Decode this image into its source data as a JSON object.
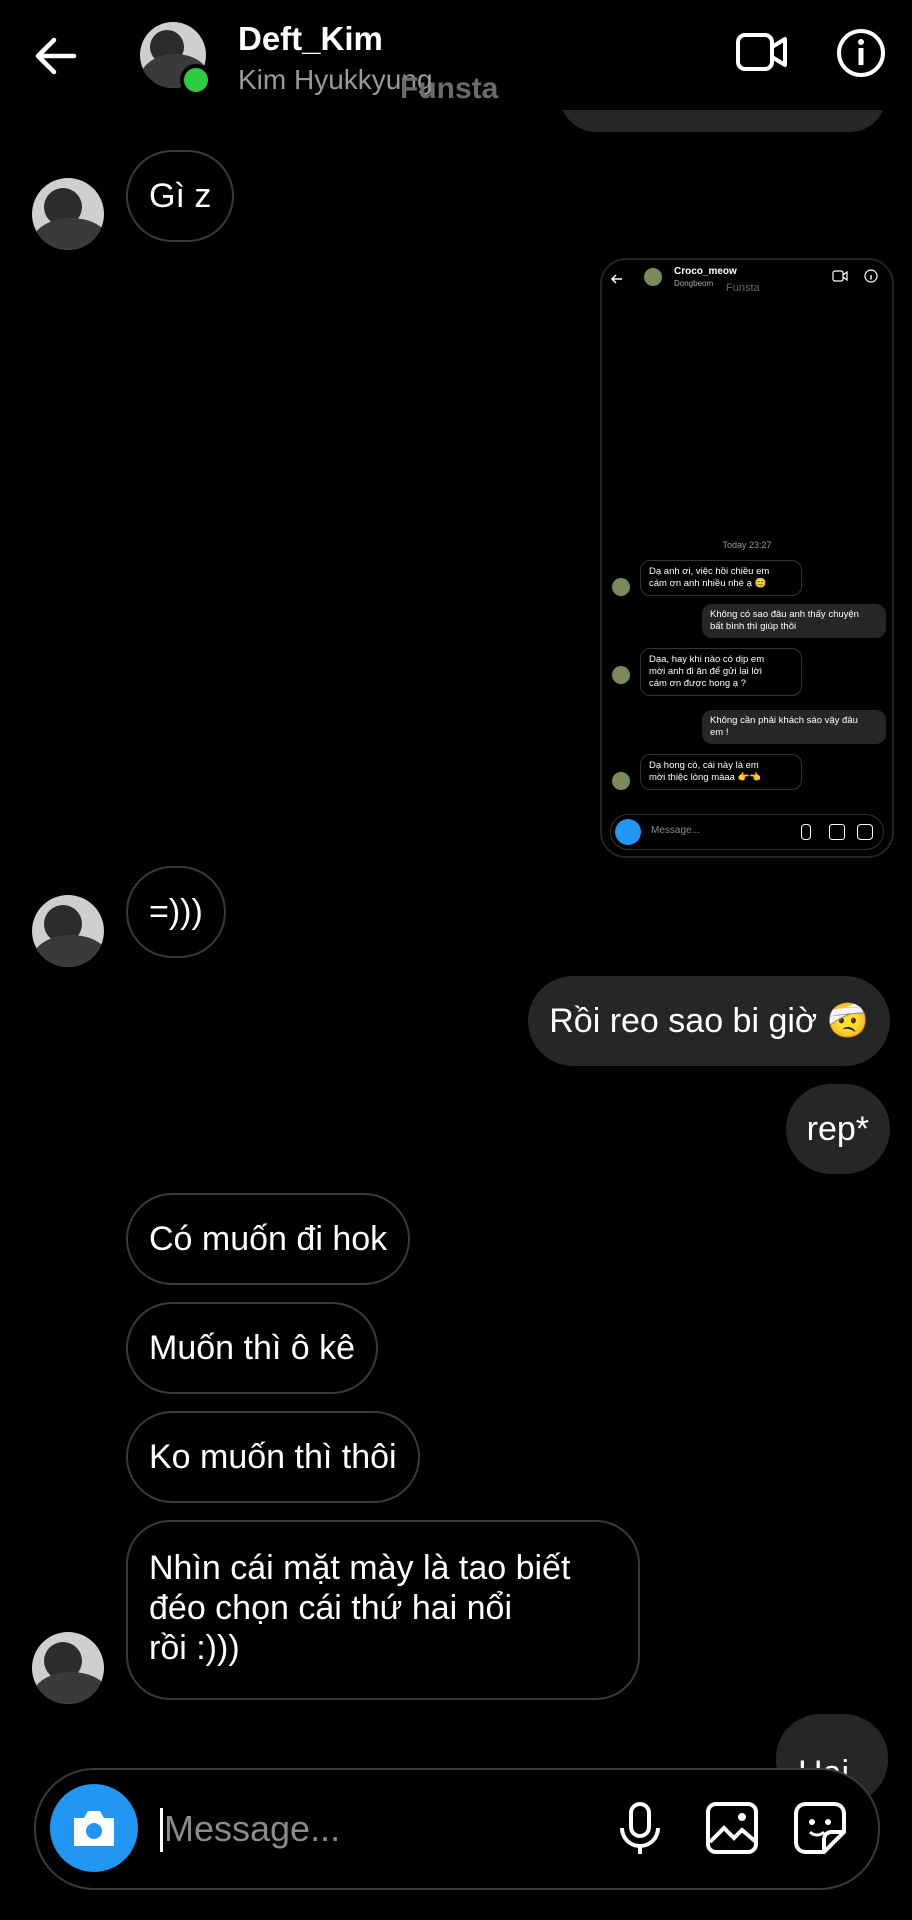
{
  "header": {
    "name": "Deft_Kim",
    "username": "Kim Hyukkyung",
    "overlay_text": "Funsta"
  },
  "messages": {
    "m1": "Gì z",
    "m2": "=)))",
    "m3": "Rồi reo sao bi giờ 🤕",
    "m4": "rep*",
    "m5": "Có muốn đi hok",
    "m6": "Muốn thì ô kê",
    "m7": "Ko muốn thì thôi",
    "m8_lines": [
      "Nhìn cái mặt mày là tao biết",
      "đéo chọn cái thứ hai nổi",
      "rồi :)))"
    ],
    "partial": "Hai"
  },
  "screenshot": {
    "name": "Croco_meow",
    "username": "Dongbeom",
    "overlay_text": "Funsta",
    "time": "Today 23:27",
    "msgs": [
      {
        "dir": "in",
        "lines": [
          "Dạ anh ơi, việc hồi chiều em",
          "cám ơn anh nhiều nhé ạ 😊"
        ]
      },
      {
        "dir": "out",
        "lines": [
          "Không có sao đâu anh thấy chuyện",
          "bất bình thì giúp thôi"
        ]
      },
      {
        "dir": "in",
        "lines": [
          "Dạa, hay khi nào có dịp em",
          "mời anh đi ăn để gửi lại lời",
          "cám ơn được hong ạ ?"
        ]
      },
      {
        "dir": "out",
        "lines": [
          "Không cần phải khách sáo vậy đâu",
          "em !"
        ]
      },
      {
        "dir": "in",
        "lines": [
          "Dạ hong có, cái này là em",
          "mời thiệc lòng màaa 👉👈"
        ]
      }
    ],
    "placeholder": "Message..."
  },
  "composer": {
    "placeholder": "Message..."
  },
  "colors": {
    "online": "#2ecc40",
    "camera": "#2196f3",
    "bubble_out": "#262626",
    "bubble_in_border": "#3a3a3a"
  }
}
